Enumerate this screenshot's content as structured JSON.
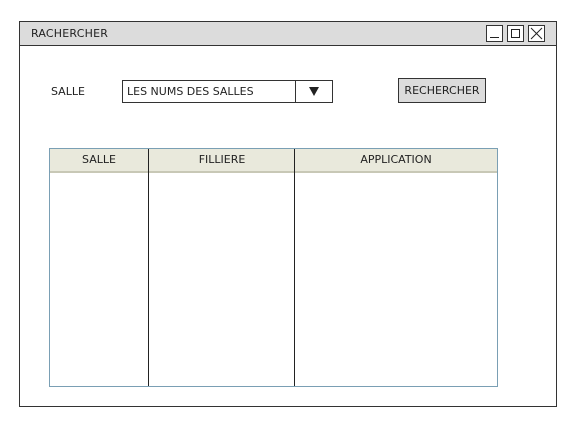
{
  "window": {
    "title": "RACHERCHER"
  },
  "form": {
    "salle_label": "SALLE",
    "select_value": "LES NUMS DES SALLES",
    "search_button": "RECHERCHER"
  },
  "table": {
    "columns": [
      "SALLE",
      "FILLIERE",
      "APPLICATION"
    ],
    "rows": []
  },
  "colors": {
    "titlebar": "#dcdcdc",
    "table_header": "#e9e9dc",
    "table_border": "#7a9fb4"
  }
}
